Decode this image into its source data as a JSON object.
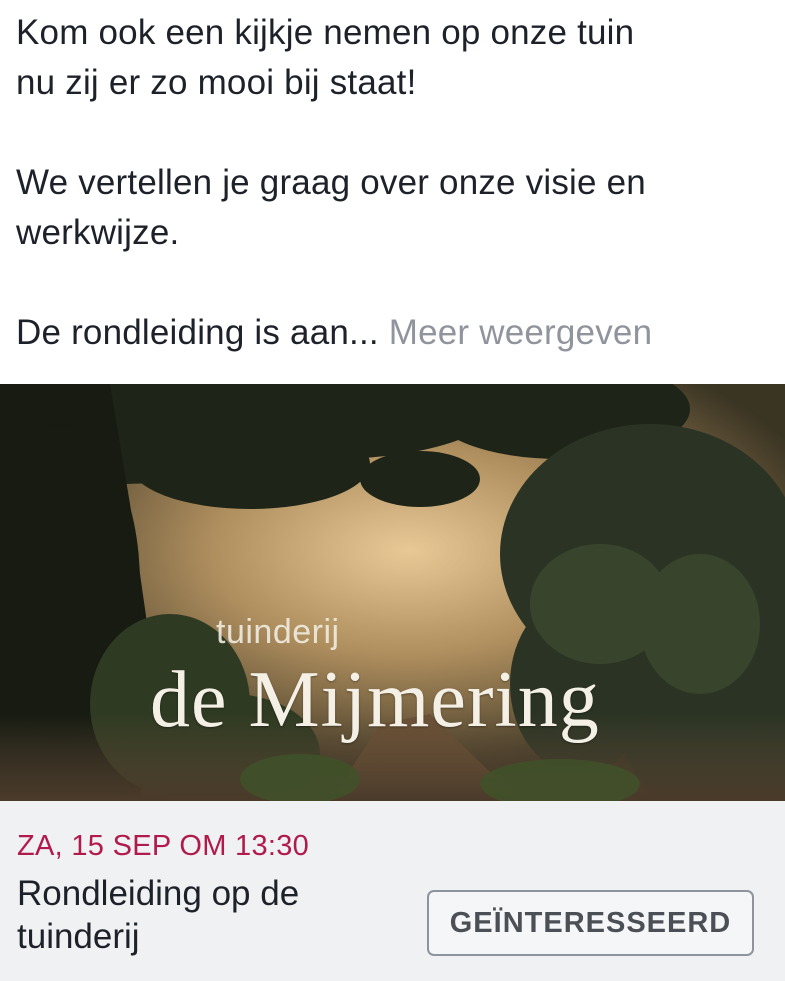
{
  "post": {
    "line1": "Kom ook een kijkje nemen op onze tuin",
    "line2": "nu zij er zo mooi bij staat!",
    "line3": "We vertellen je graag over onze visie en",
    "line4": "werkwijze.",
    "line5": "De rondleiding is aan...",
    "more_link": "Meer weergeven"
  },
  "cover": {
    "small_text": "tuinderij",
    "big_text": "de Mijmering"
  },
  "event": {
    "date": "ZA, 15 SEP OM 13:30",
    "title": "Rondleiding op de tuinderij",
    "interested_label": "GEÏNTERESSEERD"
  },
  "colors": {
    "date_accent": "#b01b4c",
    "link_gray": "#90949c",
    "text": "#1d2129"
  }
}
